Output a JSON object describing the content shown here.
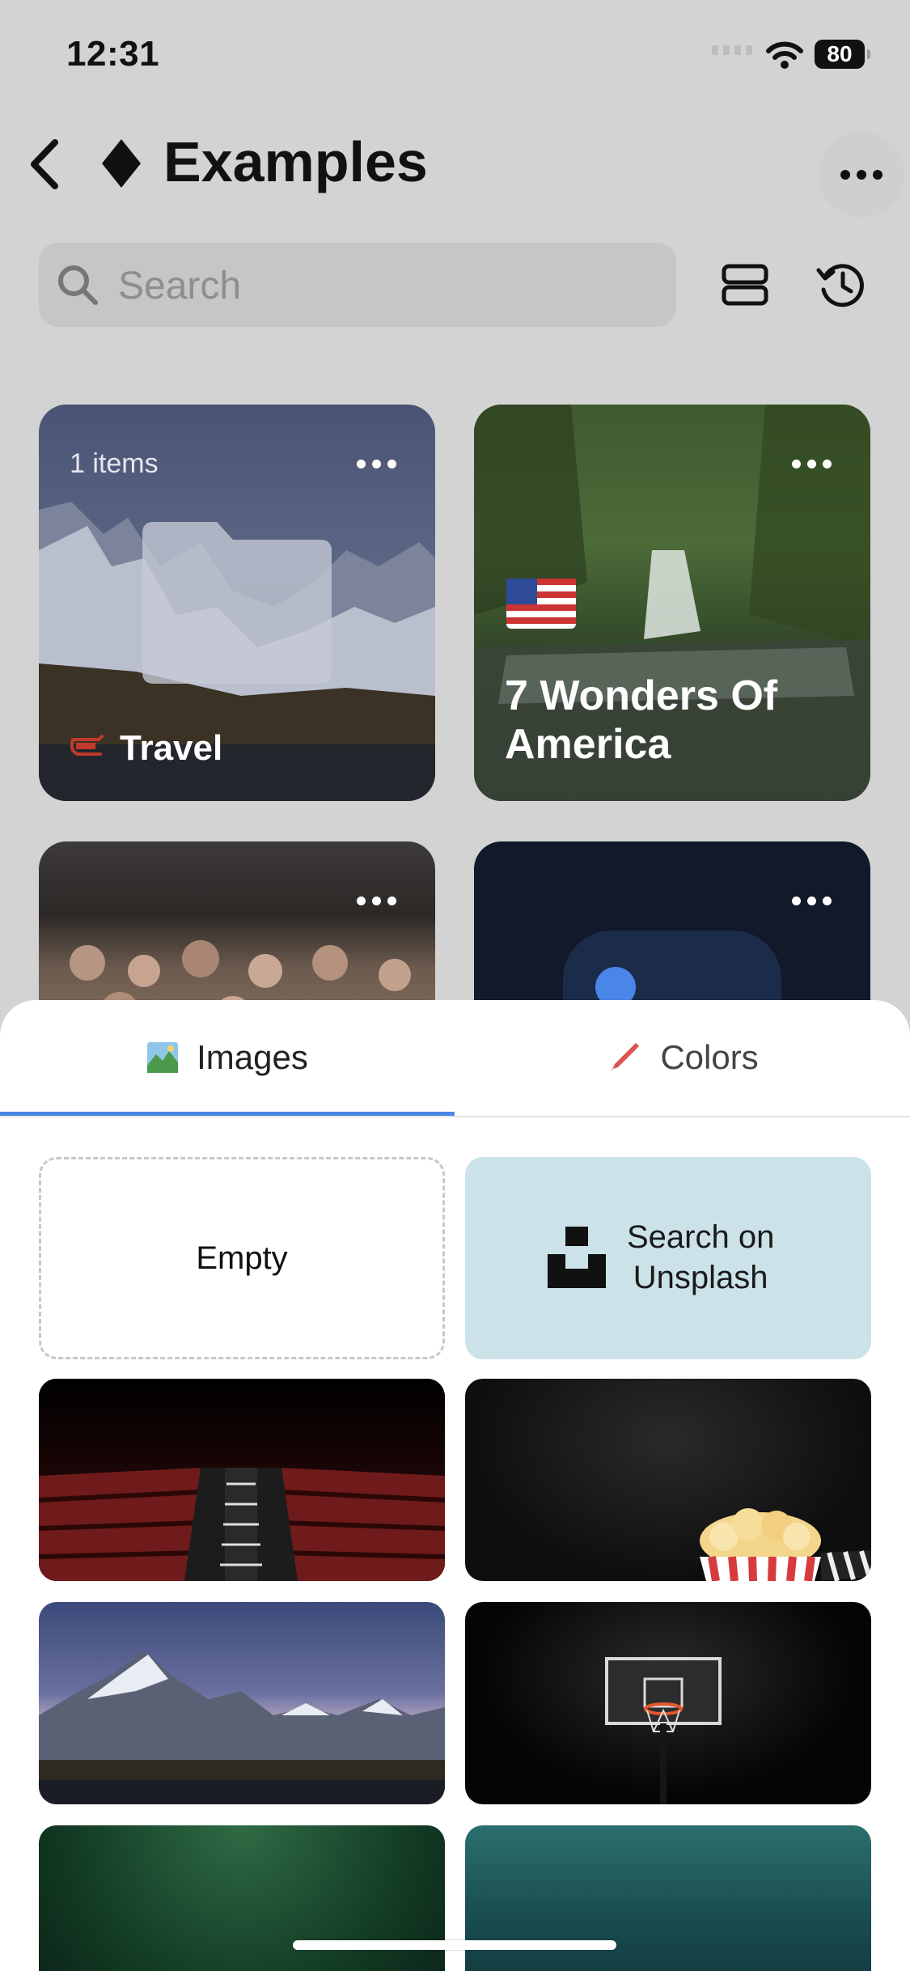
{
  "status": {
    "time": "12:31",
    "battery": "80"
  },
  "header": {
    "title": "Examples"
  },
  "search": {
    "placeholder": "Search"
  },
  "cards": [
    {
      "count": "1 items",
      "label": "Travel"
    },
    {
      "label": "7 Wonders Of America"
    },
    {},
    {}
  ],
  "sheet": {
    "tabs": [
      {
        "label": "Images",
        "active": true
      },
      {
        "label": "Colors",
        "active": false
      }
    ],
    "empty_label": "Empty",
    "unsplash_label_line1": "Search on",
    "unsplash_label_line2": "Unsplash"
  },
  "colors": {
    "accent": "#4a86e8",
    "unsplash_tile": "#cbe3e8",
    "backdrop": "#d3d3d3"
  }
}
